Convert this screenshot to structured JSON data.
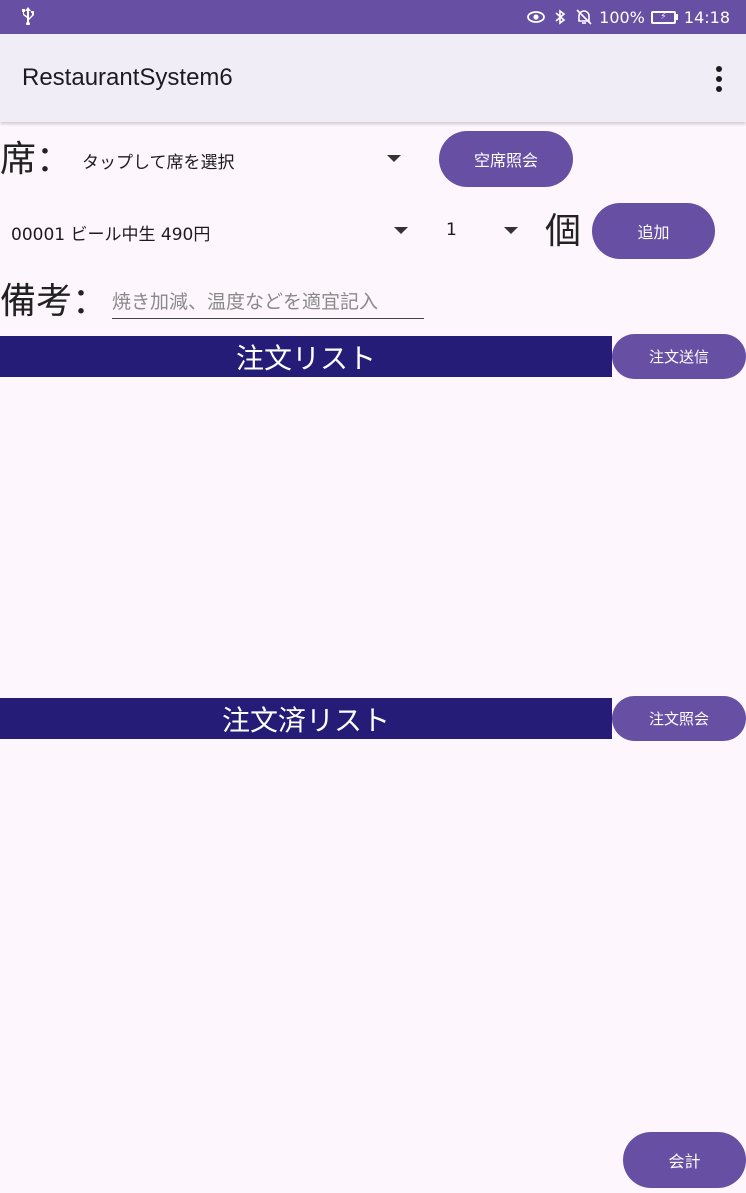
{
  "status_bar": {
    "battery_percent": "100%",
    "time": "14:18",
    "icons": [
      "usb-icon",
      "eye-icon",
      "bluetooth-icon",
      "bell-off-icon",
      "battery-icon"
    ]
  },
  "app_bar": {
    "title": "RestaurantSystem6",
    "menu_icon": "more-vert-icon"
  },
  "seat": {
    "label": "席：",
    "selected_value": "タップして席を選択",
    "vacancy_button": "空席照会"
  },
  "order_entry": {
    "item_selected": "00001 ビール中生 490円",
    "quantity_selected": "1",
    "unit_label": "個",
    "add_button": "追加"
  },
  "remark": {
    "label": "備考：",
    "placeholder": "焼き加減、温度などを適宜記入",
    "value": ""
  },
  "order_list": {
    "header": "注文リスト",
    "send_button": "注文送信",
    "items": []
  },
  "ordered_list": {
    "header": "注文済リスト",
    "inquiry_button": "注文照会",
    "items": []
  },
  "checkout_button": "会計",
  "colors": {
    "primary": "#674fa3",
    "band": "#251c78",
    "background": "#fdf7fd",
    "appbar": "#f1edf6"
  }
}
